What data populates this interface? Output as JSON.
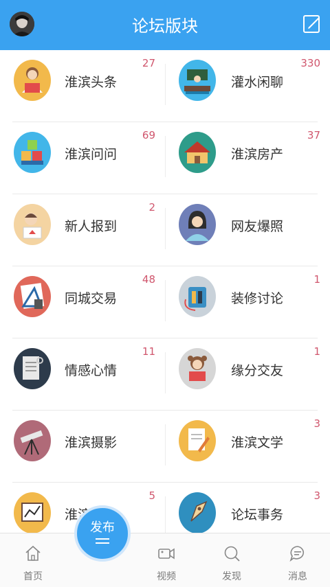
{
  "header": {
    "title": "论坛版块"
  },
  "forums": [
    {
      "left": {
        "icon": "reading-person-icon",
        "color": "#f2b94b",
        "label": "淮滨头条",
        "count": "27"
      },
      "right": {
        "icon": "classroom-icon",
        "color": "#42b6e9",
        "label": "灌水闲聊",
        "count": "330"
      }
    },
    {
      "left": {
        "icon": "blocks-icon",
        "color": "#42b6e9",
        "label": "淮滨问问",
        "count": "69"
      },
      "right": {
        "icon": "house-icon",
        "color": "#2e9c8a",
        "label": "淮滨房产",
        "count": "37"
      }
    },
    {
      "left": {
        "icon": "newcomer-icon",
        "color": "#f4d4a2",
        "label": "新人报到",
        "count": "2"
      },
      "right": {
        "icon": "woman-icon",
        "color": "#6f7fb8",
        "label": "网友爆照",
        "count": ""
      }
    },
    {
      "left": {
        "icon": "drawing-tools-icon",
        "color": "#e0685a",
        "label": "同城交易",
        "count": "48"
      },
      "right": {
        "icon": "toolbox-icon",
        "color": "#c9d2da",
        "label": "装修讨论",
        "count": "1"
      }
    },
    {
      "left": {
        "icon": "notebook-icon",
        "color": "#2d3b4b",
        "label": "情感心情",
        "count": "11"
      },
      "right": {
        "icon": "girl-reading-icon",
        "color": "#d6d6d6",
        "label": "缘分交友",
        "count": "1"
      }
    },
    {
      "left": {
        "icon": "telescope-icon",
        "color": "#b06a78",
        "label": "淮滨摄影",
        "count": ""
      },
      "right": {
        "icon": "paper-pencil-icon",
        "color": "#f2b94b",
        "label": "淮滨文学",
        "count": "3"
      }
    },
    {
      "left": {
        "icon": "chart-board-icon",
        "color": "#f2b94b",
        "label": "淮滨商讯",
        "count": "5"
      },
      "right": {
        "icon": "fountain-pen-icon",
        "color": "#2f8fbf",
        "label": "论坛事务",
        "count": "3"
      }
    }
  ],
  "tabbar": {
    "home": "首页",
    "publish": "发布",
    "video": "视频",
    "discover": "发现",
    "messages": "消息"
  },
  "colors": {
    "accent": "#3aa2f0",
    "count": "#d0566d"
  }
}
